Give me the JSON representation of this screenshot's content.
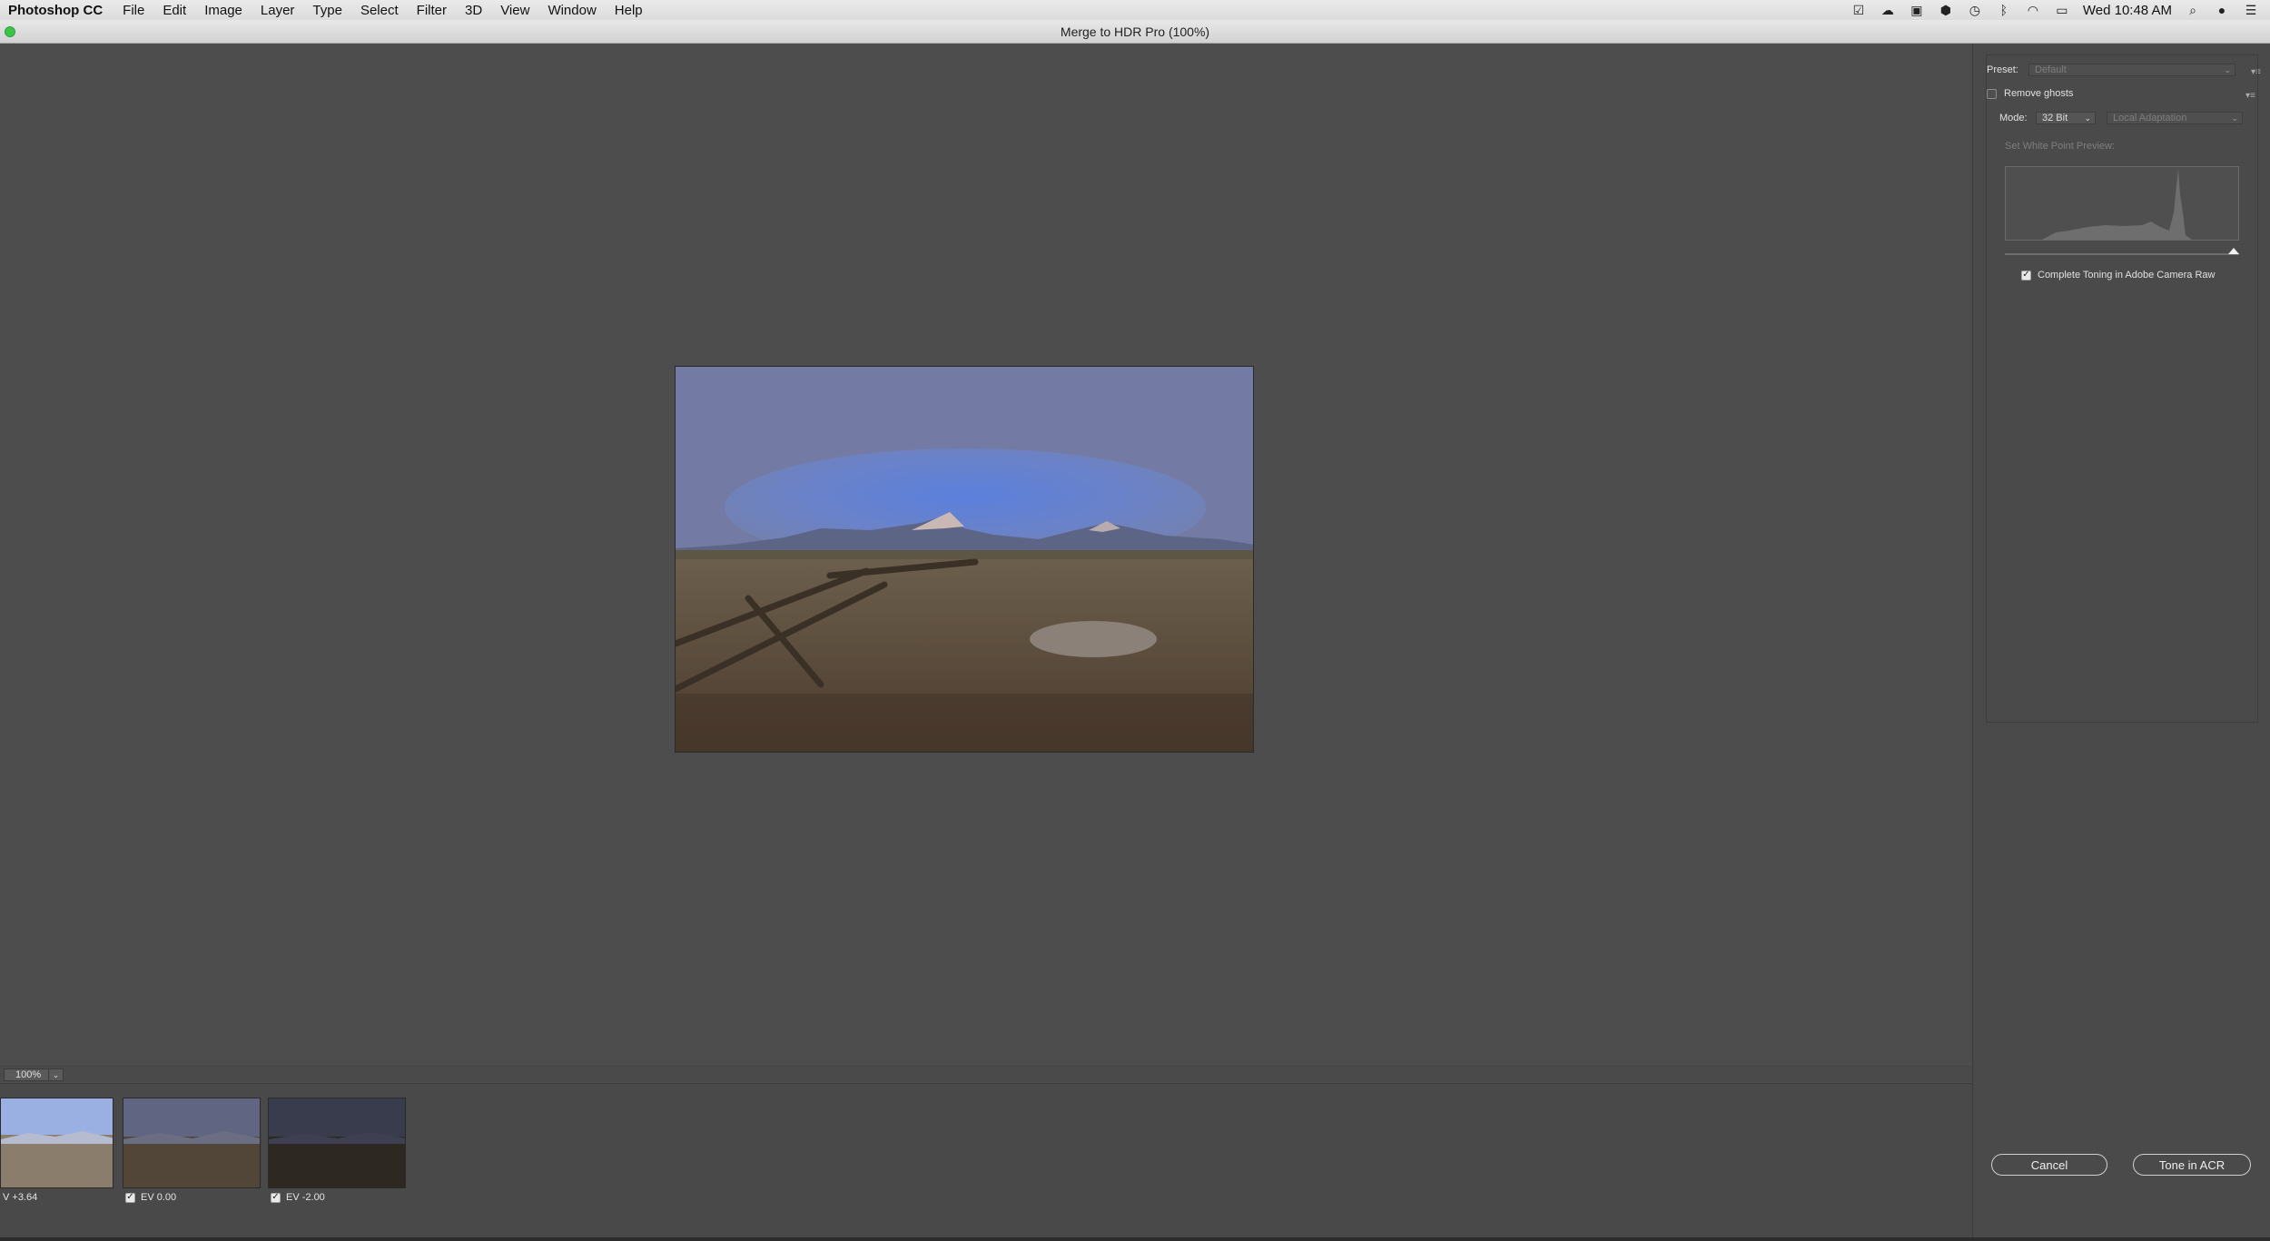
{
  "menubar": {
    "app_name": "Photoshop CC",
    "items": [
      "File",
      "Edit",
      "Image",
      "Layer",
      "Type",
      "Select",
      "Filter",
      "3D",
      "View",
      "Window",
      "Help"
    ],
    "clock": "Wed 10:48 AM",
    "status_icons": [
      "check-circle-icon",
      "creative-cloud-icon",
      "display-icon",
      "location-icon",
      "time-machine-icon",
      "bluetooth-icon",
      "wifi-icon",
      "airplay-icon",
      "search-icon",
      "siri-icon",
      "notification-center-icon"
    ]
  },
  "window": {
    "title": "Merge to HDR Pro (100%)"
  },
  "zoom": {
    "value": "100%"
  },
  "filmstrip": [
    {
      "label": "V +3.64",
      "checked": false
    },
    {
      "label": "EV 0.00",
      "checked": true
    },
    {
      "label": "EV -2.00",
      "checked": true
    }
  ],
  "panel": {
    "preset_label": "Preset:",
    "preset_value": "Default",
    "remove_ghosts_label": "Remove ghosts",
    "mode_label": "Mode:",
    "mode_value": "32 Bit",
    "method_value": "Local Adaptation",
    "white_point_label": "Set White Point Preview:",
    "complete_toning_label": "Complete Toning in Adobe Camera Raw",
    "complete_toning_checked": true
  },
  "buttons": {
    "cancel": "Cancel",
    "tone": "Tone in ACR"
  },
  "colors": {
    "sky": "#5b7fd1",
    "grass": "#6b5a46",
    "panel_bg": "#4a4a4a"
  }
}
